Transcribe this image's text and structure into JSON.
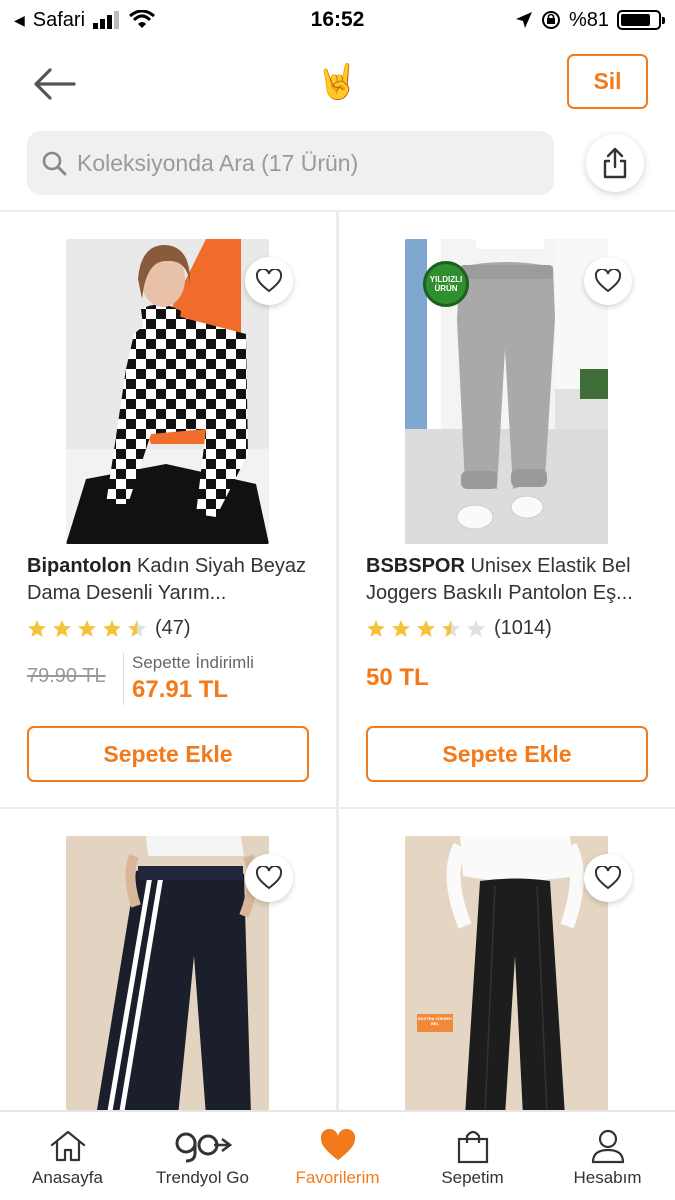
{
  "status_bar": {
    "carrier": "Safari",
    "time": "16:52",
    "battery_text": "%81",
    "battery_level": 0.81
  },
  "header": {
    "emoji": "🤘",
    "delete_label": "Sil"
  },
  "search": {
    "placeholder": "Koleksiyonda Ara (17 Ürün)"
  },
  "products": [
    {
      "brand": "Bipantolon",
      "name": "Kadın Siyah Beyaz Dama Desenli Yarım...",
      "rating": 4.5,
      "review_count": "(47)",
      "old_price": "79.90 TL",
      "discount_note": "Sepette İndirimli",
      "price": "67.91 TL",
      "button": "Sepete Ekle"
    },
    {
      "brand": "BSBSPOR",
      "name": "Unisex Elastik Bel Joggers Baskılı Pantolon Eş...",
      "rating": 3.5,
      "review_count": "(1014)",
      "price": "50 TL",
      "badge": "YILDIZLI ÜRÜN",
      "button": "Sepete Ekle"
    },
    {
      "badge": "",
      "note": ""
    },
    {
      "image_label": "EKSTRA YÜKSEK BEL"
    }
  ],
  "tabs": [
    {
      "label": "Anasayfa",
      "icon": "home-icon"
    },
    {
      "label": "Trendyol Go",
      "icon": "go-logo-icon"
    },
    {
      "label": "Favorilerim",
      "icon": "heart-icon",
      "active": true
    },
    {
      "label": "Sepetim",
      "icon": "cart-icon"
    },
    {
      "label": "Hesabım",
      "icon": "account-icon"
    }
  ],
  "colors": {
    "accent": "#f27a1a",
    "star": "#f5c33b"
  }
}
